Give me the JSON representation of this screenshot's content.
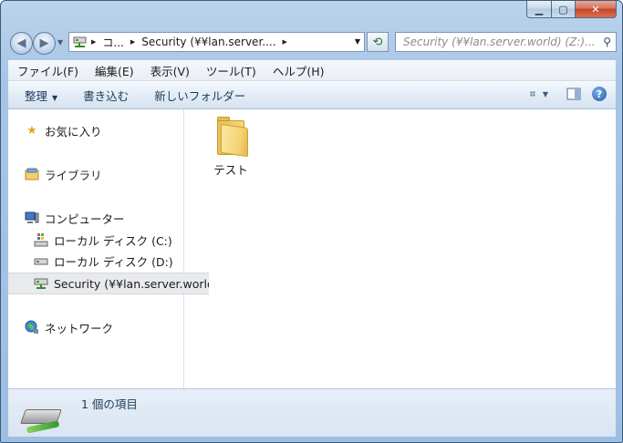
{
  "window": {
    "buttons": {
      "minimize": "▁",
      "maximize": "▢",
      "close": "✕"
    }
  },
  "nav": {
    "back_glyph": "◀",
    "forward_glyph": "▶",
    "history_dropdown": "▼",
    "breadcrumb": [
      "コ...",
      "Security (¥¥lan.server...."
    ],
    "breadcrumb_sep": "▶",
    "address_dropdown": "▼",
    "refresh_glyph": "⟲",
    "search_placeholder": "Security (¥¥lan.server.world) (Z:)...",
    "search_icon": "⚲"
  },
  "menubar": [
    "ファイル(F)",
    "編集(E)",
    "表示(V)",
    "ツール(T)",
    "ヘルプ(H)"
  ],
  "toolbar": {
    "organize": "整理",
    "organize_arrow": "▼",
    "burn": "書き込む",
    "new_folder": "新しいフォルダー",
    "view_arrow": "▼",
    "help": "?"
  },
  "navpane": {
    "favorites": "お気に入り",
    "libraries": "ライブラリ",
    "computer": "コンピューター",
    "local_c": "ローカル ディスク (C:)",
    "local_d": "ローカル ディスク (D:)",
    "network_drive": "Security (¥¥lan.server.world) (Z:)",
    "network": "ネットワーク"
  },
  "files": [
    {
      "name": "テスト",
      "type": "folder"
    }
  ],
  "status": {
    "count_text": "1 個の項目"
  }
}
